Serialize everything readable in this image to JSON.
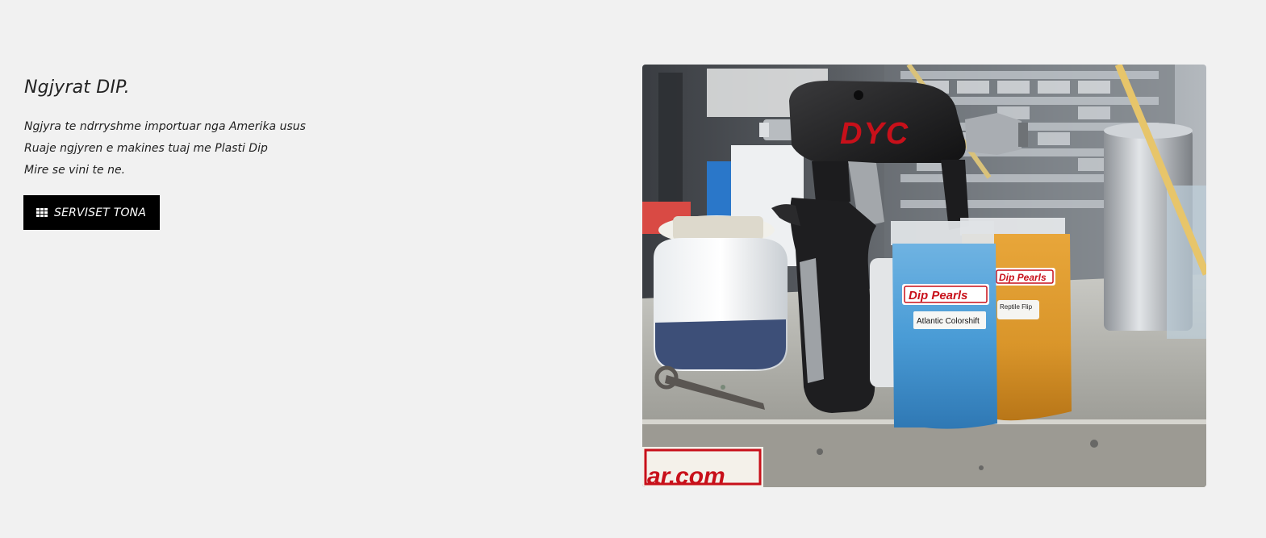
{
  "hero": {
    "title": "Ngjyrat DIP.",
    "lines": [
      "Ngjyra te ndrryshme importuar nga Amerika usus",
      "Ruaje ngjyren e makines tuaj me Plasti Dip",
      "Mire se vini te ne."
    ],
    "button": {
      "icon": "grid-icon",
      "label": "SERVISET TONA"
    }
  },
  "photo": {
    "gun_brand": "DYC",
    "bag_blue_brand": "Dip Pearls",
    "bag_blue_color": "Atlantic Colorshift",
    "bag_gold_brand": "Dip Pearls",
    "bag_gold_color": "Reptile Flip",
    "sticker_text": "ar.com"
  },
  "colors": {
    "page_background": "#f1f1f1",
    "button_background": "#000000",
    "button_text": "#ffffff",
    "brand_red": "#c8101a",
    "pearl_blue": "#4a9cd6",
    "pearl_gold": "#d9952a"
  }
}
